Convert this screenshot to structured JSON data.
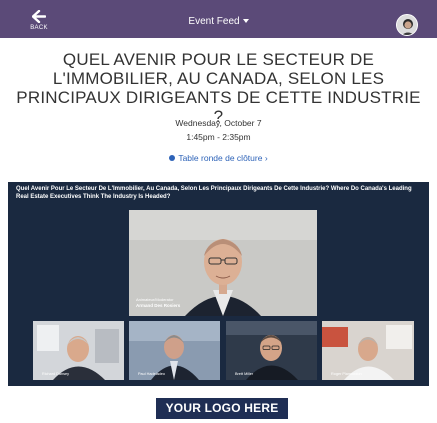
{
  "header": {
    "back_label": "BACK",
    "feed_label": "Event Feed",
    "background_color": "#5b4a78"
  },
  "event": {
    "title": "QUEL AVENIR POUR LE SECTEUR DE L'IMMOBILIER, AU CANADA, SELON LES PRINCIPAUX DIRIGEANTS DE CETTE INDUSTRIE ?",
    "date": "Wednesday, October 7",
    "time": "1:45pm - 2:35pm",
    "session_label": "Table ronde de clôture",
    "session_color": "#2e63b8"
  },
  "video": {
    "title": "Quel Avenir Pour Le Secteur De L'Immobilier, Au Canada, Selon Les Principaux Dirigeants De Cette Industrie? Where Do Canada's Leading Real Estate Executives Think The Industry Is Headed?",
    "moderator_role": "Animateur/Moderator",
    "moderator_name": "Armand Des Rosiers",
    "panelists": [
      {
        "name": "Richard Dansey"
      },
      {
        "name": "Paul Hadeladeo"
      },
      {
        "name": "Brett Miller"
      },
      {
        "name": "Roger Plamondon"
      }
    ],
    "panel_color": "#1a2940"
  },
  "logo": {
    "text": "YOUR LOGO HERE",
    "background_color": "#1f2e54"
  }
}
